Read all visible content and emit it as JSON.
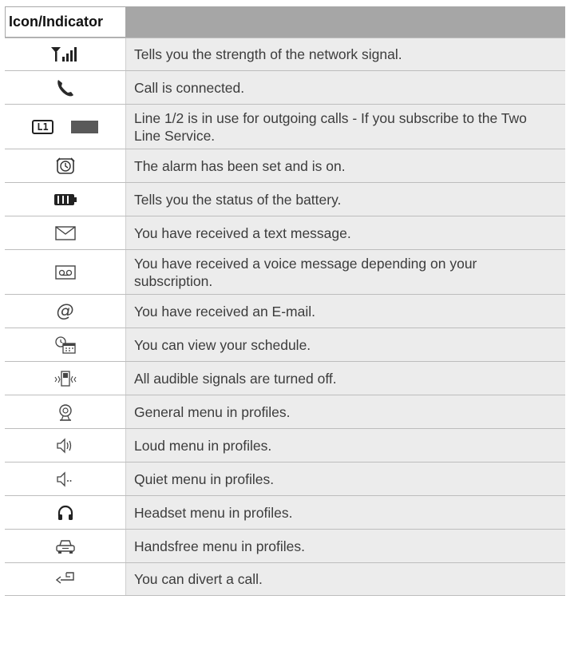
{
  "header": {
    "col1": "Icon/Indicator",
    "col2": ""
  },
  "rows": [
    {
      "icon": "signal-strength-icon",
      "text": "Tells you the strength of the network signal."
    },
    {
      "icon": "call-connected-icon",
      "text": "Call is connected."
    },
    {
      "icon": "line-1-2-icon",
      "icon_text": "L1",
      "text": "Line 1/2 is in use for outgoing calls - If you subscribe to the Two Line Service."
    },
    {
      "icon": "alarm-clock-icon",
      "text": "The alarm has been set and is on."
    },
    {
      "icon": "battery-icon",
      "text": "Tells you the status of the battery."
    },
    {
      "icon": "text-message-icon",
      "text": "You have received a text message."
    },
    {
      "icon": "voice-message-icon",
      "text": "You have received a voice message depending on your subscription."
    },
    {
      "icon": "email-icon",
      "text": "You have received an E-mail."
    },
    {
      "icon": "schedule-icon",
      "text": "You can view your schedule."
    },
    {
      "icon": "silent-vibrate-icon",
      "text": "All audible signals are turned off."
    },
    {
      "icon": "general-profile-icon",
      "text": "General menu in profiles."
    },
    {
      "icon": "loud-profile-icon",
      "text": "Loud menu in profiles."
    },
    {
      "icon": "quiet-profile-icon",
      "text": "Quiet menu in profiles."
    },
    {
      "icon": "headset-profile-icon",
      "text": "Headset menu in profiles."
    },
    {
      "icon": "handsfree-car-icon",
      "text": "Handsfree menu in profiles."
    },
    {
      "icon": "call-divert-icon",
      "text": "You can divert a call."
    }
  ]
}
